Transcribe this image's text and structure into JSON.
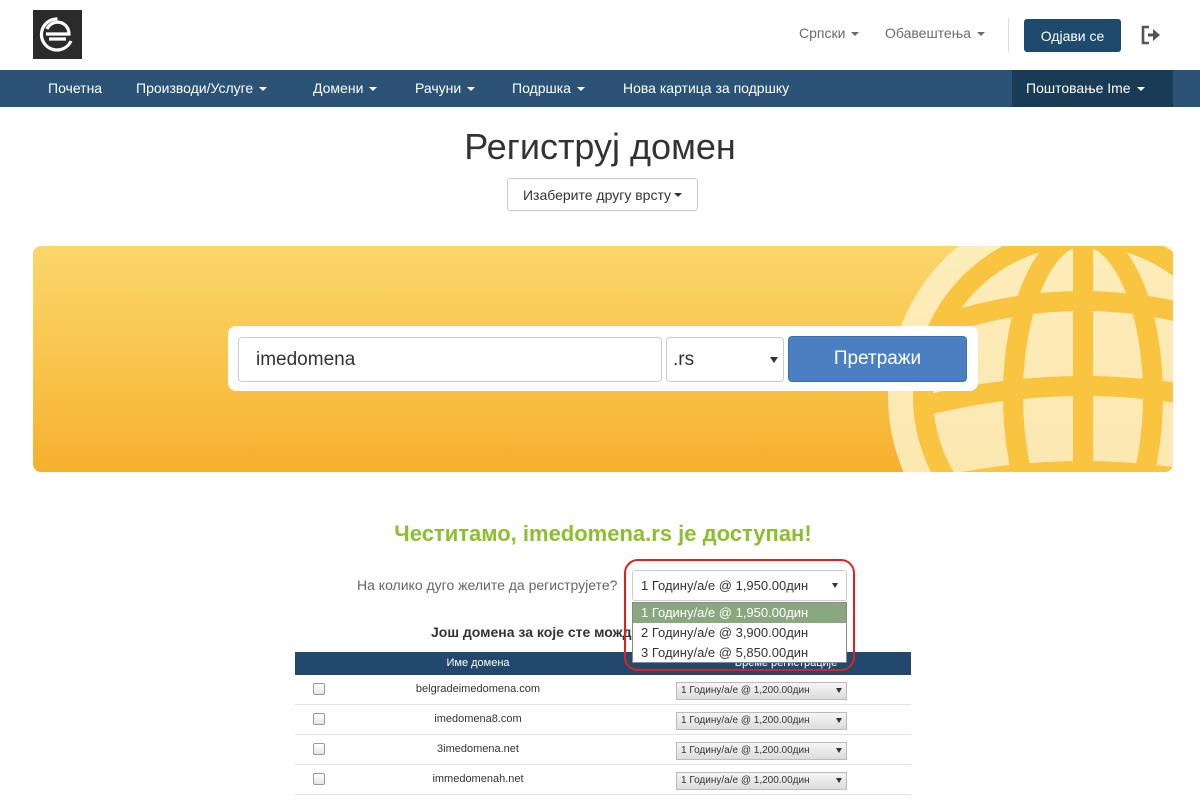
{
  "header": {
    "language": "Српски",
    "notifications": "Обавештења",
    "logout_label": "Одјави се"
  },
  "nav": {
    "items": [
      {
        "label": "Почетна"
      },
      {
        "label": "Производи/Услуге"
      },
      {
        "label": "Домени"
      },
      {
        "label": "Рачуни"
      },
      {
        "label": "Подршка"
      },
      {
        "label": "Нова картица за подршку"
      }
    ],
    "account": "Поштовање Ime"
  },
  "page": {
    "title": "Региструј домен",
    "type_button": "Изаберите другу врсту"
  },
  "search": {
    "query": "imedomena",
    "tld": ".rs",
    "button": "Претражи"
  },
  "result": {
    "message": "Честитамо, imedomena.rs је доступан!",
    "period_label": "На колико дуго желите да региструјете?",
    "period_selected": "1 Годину/а/е @ 1,950.00дин",
    "period_options": [
      "1 Годину/а/е @ 1,950.00дин",
      "2 Годину/а/е @ 3,900.00дин",
      "3 Годину/а/е @ 5,850.00дин"
    ],
    "more_label": "Још домена за које сте можда"
  },
  "table": {
    "col_domain": "Име домена",
    "col_period": "Време регистрације",
    "rows": [
      {
        "domain": "belgradeimedomena.com",
        "period": "1 Годину/а/е @ 1,200.00дин"
      },
      {
        "domain": "imedomena8.com",
        "period": "1 Годину/а/е @ 1,200.00дин"
      },
      {
        "domain": "3imedomena.net",
        "period": "1 Годину/а/е @ 1,200.00дин"
      },
      {
        "domain": "immedomenah.net",
        "period": "1 Годину/а/е @ 1,200.00дин"
      }
    ]
  },
  "colors": {
    "nav_bg": "#2a5375",
    "primary_button": "#4a7fc1",
    "success_text": "#8cbf2e",
    "banner_yellow": "#f9c34a"
  }
}
